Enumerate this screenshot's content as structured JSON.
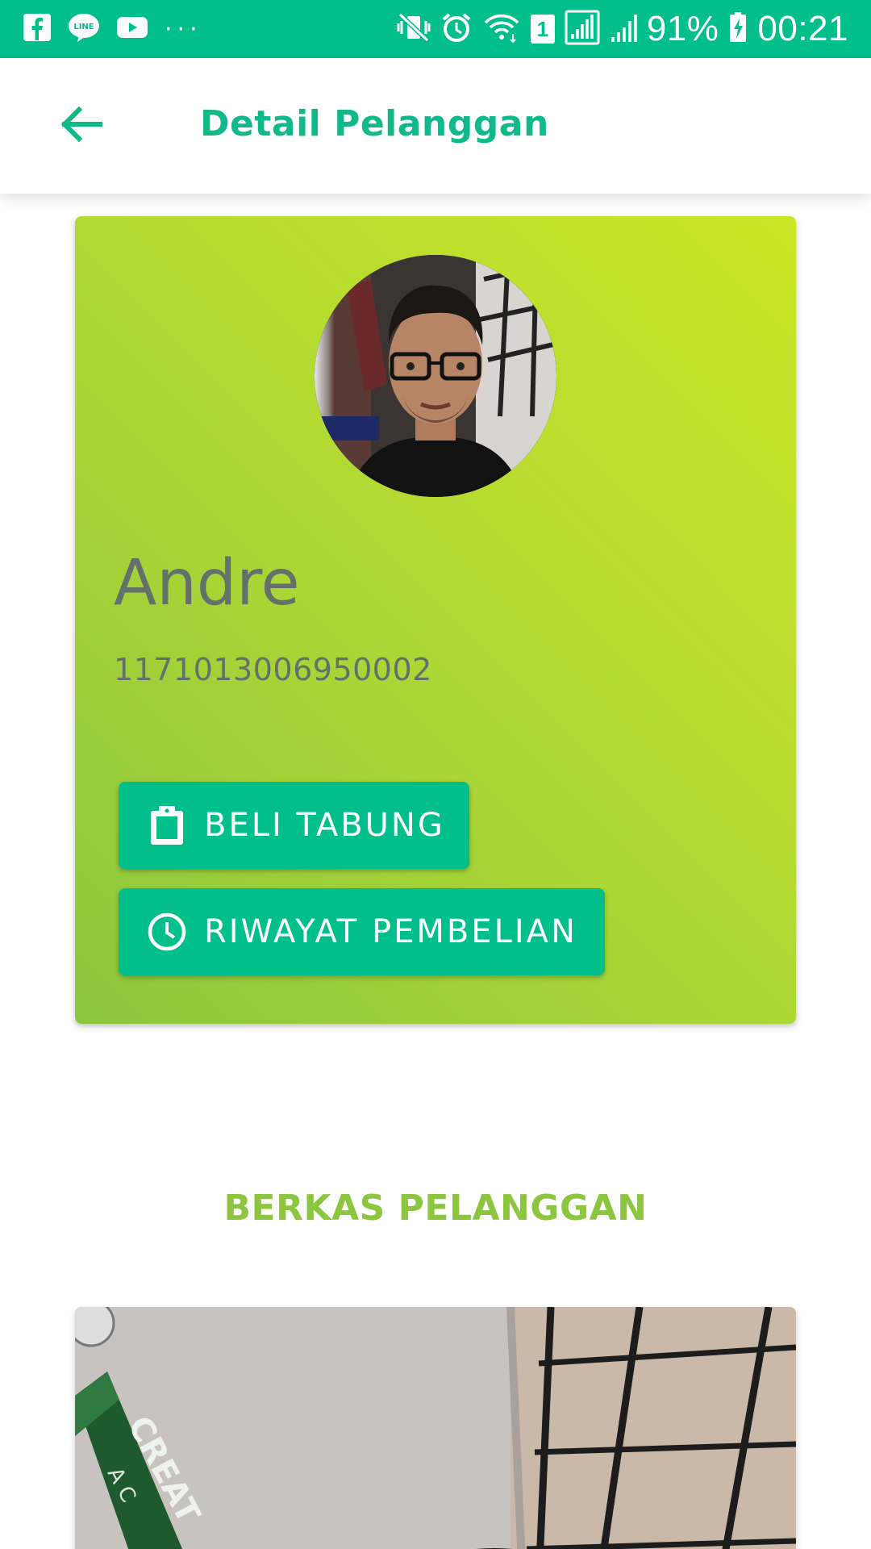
{
  "status_bar": {
    "left_icons": [
      "facebook-icon",
      "line-icon",
      "youtube-icon"
    ],
    "more": "···",
    "battery": "91%",
    "time": "00:21",
    "sim_badge": "1"
  },
  "app_bar": {
    "title": "Detail Pelanggan"
  },
  "profile": {
    "name": "Andre",
    "id_number": "1171013006950002"
  },
  "actions": {
    "beli_tabung": "BELI TABUNG",
    "riwayat_pembelian": "RIWAYAT PEMBELIAN"
  },
  "documents": {
    "section_title": "BERKAS PELANGGAN"
  },
  "colors": {
    "primary": "#00BF8A",
    "accent_green": "#8CC63F",
    "card_gradient_start": "#CBE624",
    "card_gradient_end": "#8CC63F",
    "text_gray": "#66706a"
  }
}
